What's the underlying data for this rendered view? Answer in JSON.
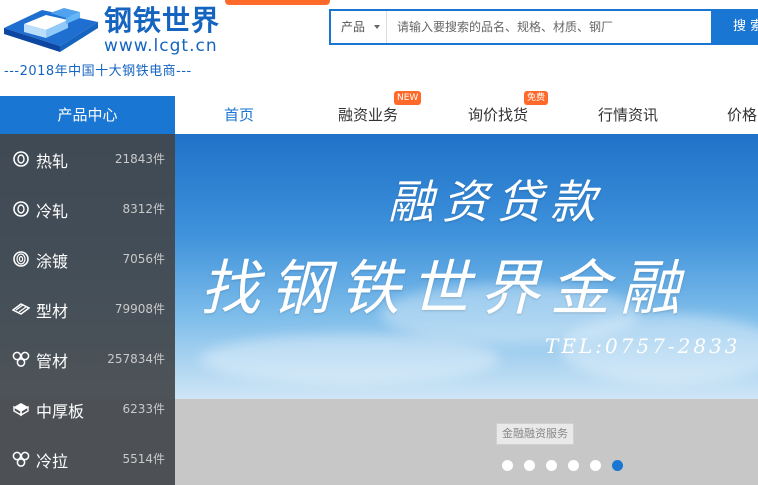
{
  "logo": {
    "title": "钢铁世界",
    "url": "www.lcgt.cn",
    "slogan": "---2018年中国十大钢铁电商---"
  },
  "search": {
    "category": "产品",
    "placeholder": "请输入要搜索的品名、规格、材质、钢厂",
    "button_label": "搜 索"
  },
  "nav": {
    "category_label": "产品中心",
    "items": [
      {
        "label": "首页",
        "badge": ""
      },
      {
        "label": "融资业务",
        "badge": "NEW"
      },
      {
        "label": "询价找货",
        "badge": "免费"
      },
      {
        "label": "行情资讯",
        "badge": ""
      },
      {
        "label": "价格",
        "badge": ""
      }
    ]
  },
  "categories": [
    {
      "name": "热轧",
      "count": "21843件",
      "icon": "coil-icon"
    },
    {
      "name": "冷轧",
      "count": "8312件",
      "icon": "coil-icon"
    },
    {
      "name": "涂镀",
      "count": "7056件",
      "icon": "coil-icon"
    },
    {
      "name": "型材",
      "count": "79908件",
      "icon": "profile-icon"
    },
    {
      "name": "管材",
      "count": "257834件",
      "icon": "pipe-icon"
    },
    {
      "name": "中厚板",
      "count": "6233件",
      "icon": "plate-icon"
    },
    {
      "name": "冷拉",
      "count": "5514件",
      "icon": "pipe-icon"
    }
  ],
  "banner": {
    "line1": "融资贷款",
    "line2": "找钢铁世界金融",
    "tel": "TEL:0757-2833",
    "caption": "金融融资服务",
    "slide_count": 6,
    "active_slide": 6
  },
  "colors": {
    "brand_blue": "#1976d2",
    "accent_orange": "#ff6a2a",
    "sidebar_bg": "#42464b"
  }
}
